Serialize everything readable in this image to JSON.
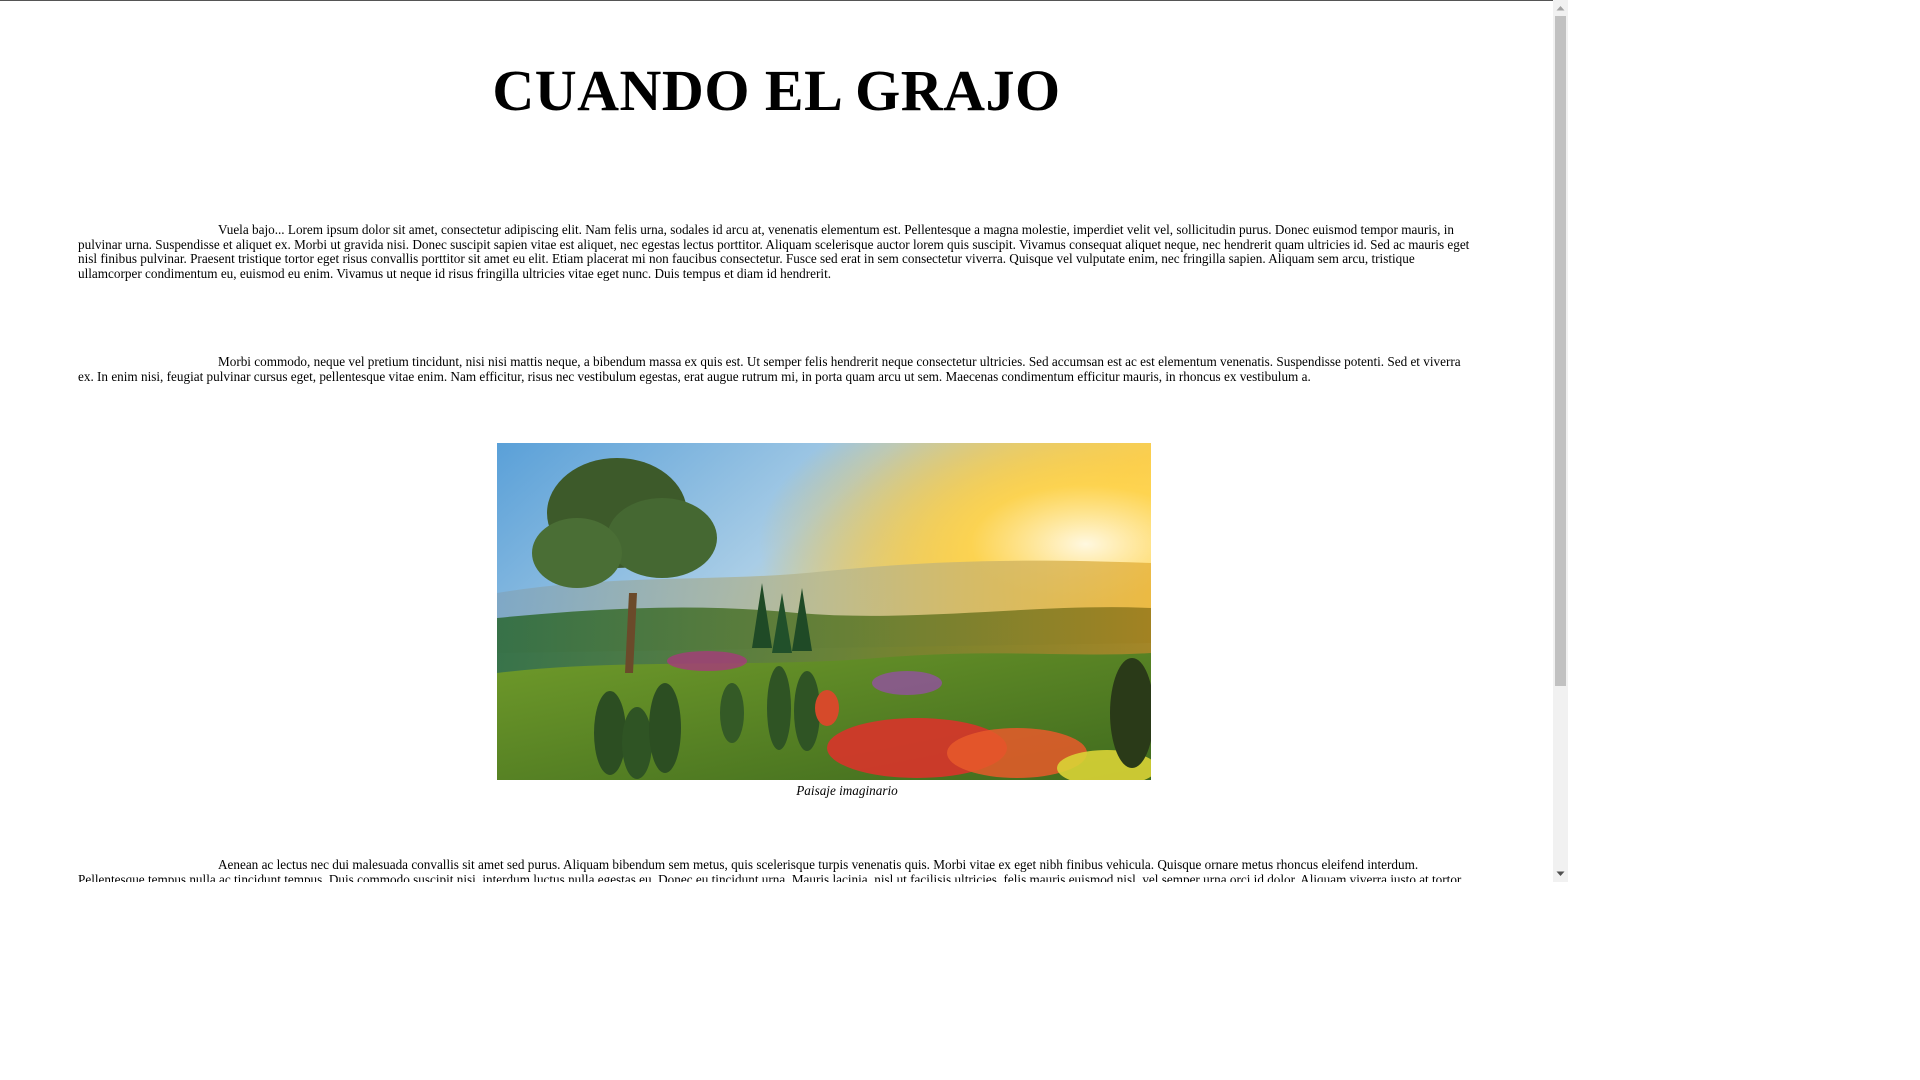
{
  "article": {
    "title": "CUANDO EL GRAJO",
    "paragraphs": [
      "Vuela bajo... Lorem ipsum dolor sit amet, consectetur adipiscing elit. Nam felis urna, sodales id arcu at, venenatis elementum est. Pellentesque a magna molestie, imperdiet velit vel, sollicitudin purus. Donec euismod tempor mauris, in pulvinar urna. Suspendisse et aliquet ex. Morbi ut gravida nisi. Donec suscipit sapien vitae est aliquet, nec egestas lectus porttitor. Aliquam scelerisque auctor lorem quis suscipit. Vivamus consequat aliquet neque, nec hendrerit quam ultricies id. Sed ac mauris eget nisl finibus pulvinar. Praesent tristique tortor eget risus convallis porttitor sit amet eu elit. Etiam placerat mi non faucibus consectetur. Fusce sed erat in sem consectetur viverra. Quisque vel vulputate enim, nec fringilla sapien. Aliquam sem arcu, tristique ullamcorper condimentum eu, euismod eu enim. Vivamus ut neque id risus fringilla ultricies vitae eget nunc. Duis tempus et diam id hendrerit.",
      "Morbi commodo, neque vel pretium tincidunt, nisi nisi mattis neque, a bibendum massa ex quis est. Ut semper felis hendrerit neque consectetur ultricies. Sed accumsan est ac est elementum venenatis. Suspendisse potenti. Sed et viverra ex. In enim nisi, feugiat pulvinar cursus eget, pellentesque vitae enim. Nam efficitur, risus nec vestibulum egestas, erat augue rutrum mi, in porta quam arcu ut sem. Maecenas condimentum efficitur mauris, in rhoncus ex vestibulum a.",
      "Aenean ac lectus nec dui malesuada convallis sit amet sed purus. Aliquam bibendum sem metus, quis scelerisque turpis venenatis quis. Morbi vitae ex eget nibh finibus vehicula. Quisque ornare metus rhoncus eleifend interdum. Pellentesque tempus nulla ac tincidunt tempus. Duis commodo suscipit nisi, interdum luctus nulla egestas eu. Donec eu tincidunt urna. Mauris lacinia, nisl ut facilisis ultricies, felis mauris euismod nisl, vel semper urna orci id dolor. Aliquam viverra justo at tortor"
    ],
    "figure": {
      "caption": "Paisaje imaginario"
    }
  },
  "colors": {
    "background": "#ffffff",
    "text": "#000000",
    "scrollbar_track": "#f1f1f1",
    "scrollbar_thumb": "#c1c1c1"
  },
  "icons": {
    "scroll_up": "triangle-up",
    "scroll_down": "triangle-down"
  }
}
